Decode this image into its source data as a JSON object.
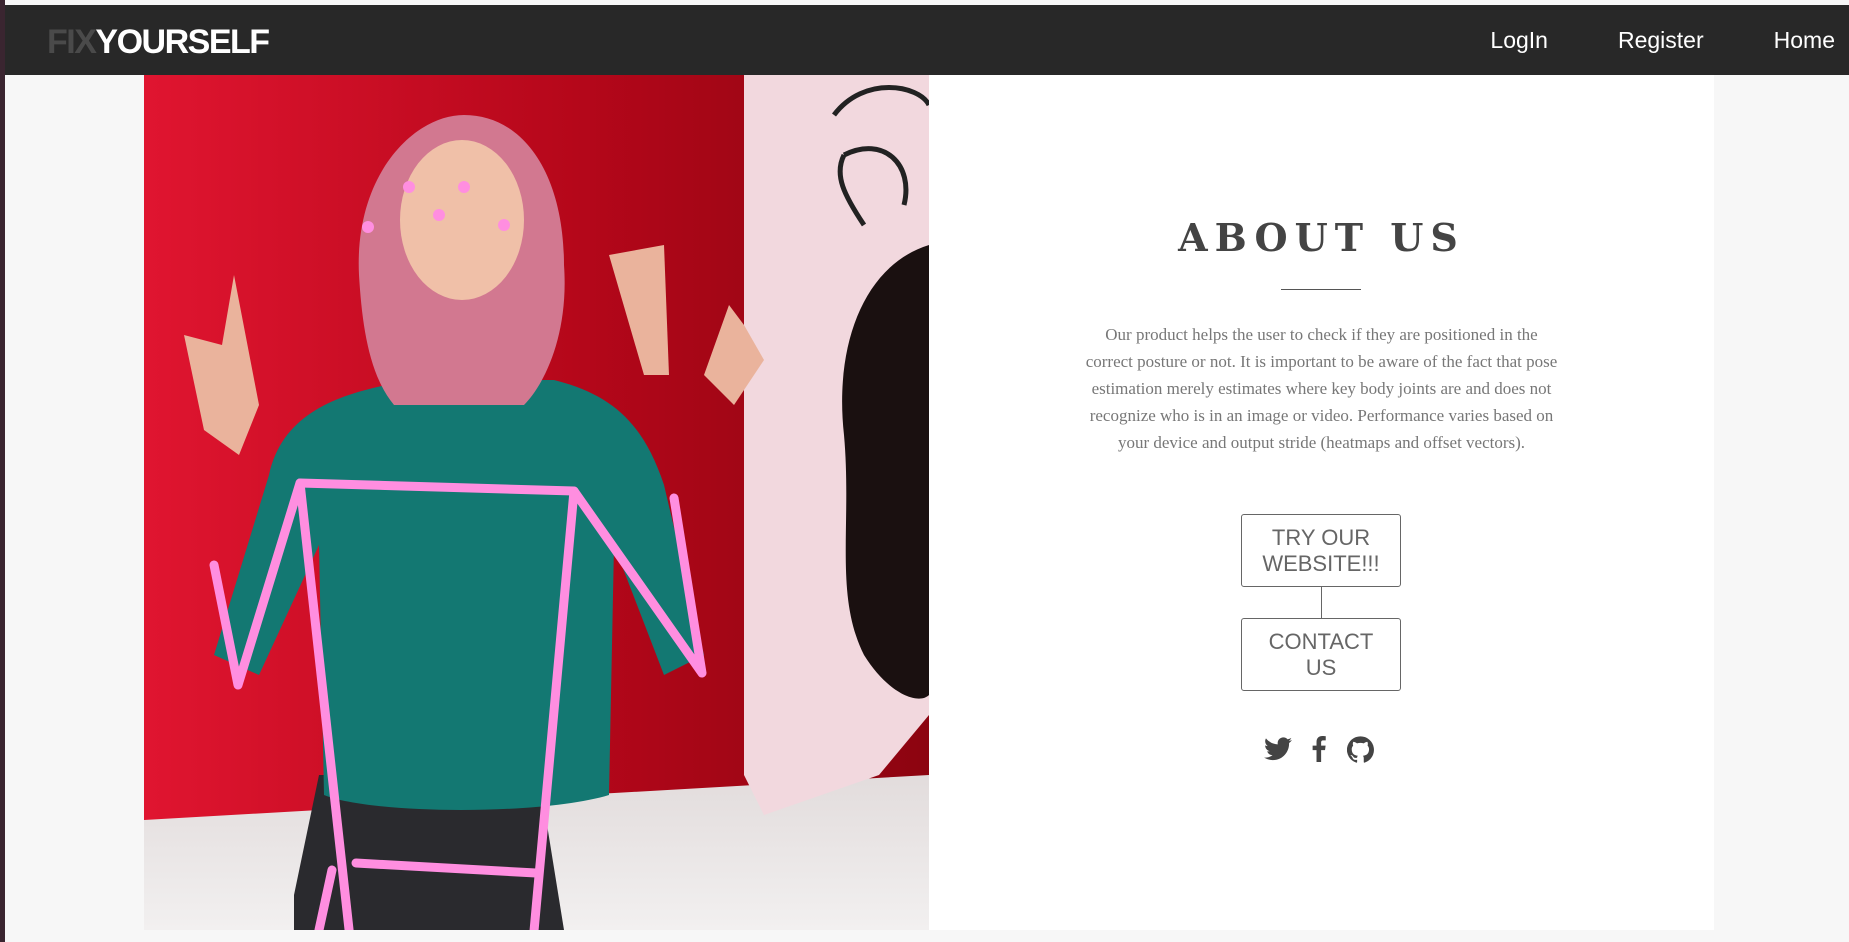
{
  "navbar": {
    "brand_dim": "FIX",
    "brand_bright": "YOURSELF",
    "links": [
      "LogIn",
      "Register",
      "Home"
    ]
  },
  "about": {
    "title": "ABOUT US",
    "text": "Our product helps the user to check if they are positioned in the correct posture or not. It is important to be aware of the fact that pose estimation merely estimates where key body joints are and does not recognize who is in an image or video. Performance varies based on your device and output stride (heatmaps and offset vectors).",
    "try_button": "TRY OUR WEBSITE!!!",
    "contact_button": "CONTACT US"
  },
  "socials": {
    "icons": [
      "twitter-icon",
      "facebook-icon",
      "github-icon"
    ]
  },
  "colors": {
    "navbar_bg": "#282828",
    "skeleton": "#ff8ee0",
    "wall_red": "#c80a1e",
    "sweater_teal": "#137872",
    "text_gray": "#777777"
  }
}
